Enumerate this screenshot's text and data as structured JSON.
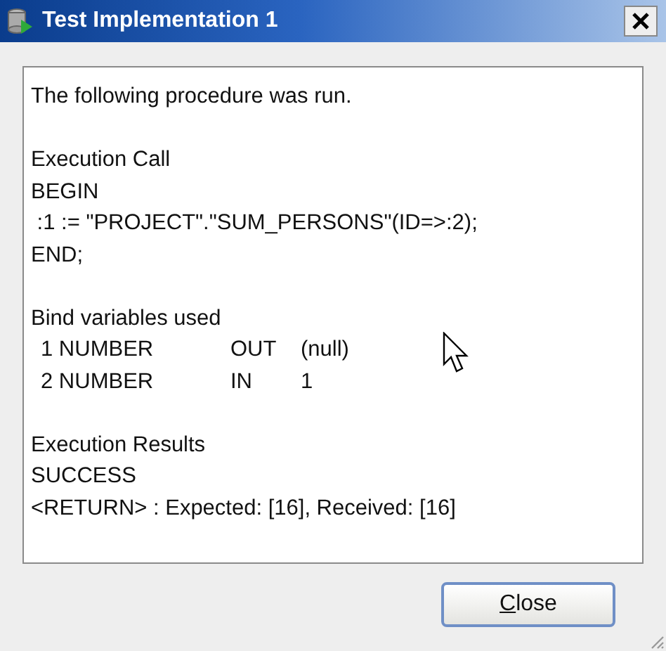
{
  "window": {
    "title": "Test Implementation 1"
  },
  "output": {
    "intro": "The following procedure was run.",
    "execution_call": {
      "heading": "Execution Call",
      "lines": [
        "BEGIN",
        " :1 := \"PROJECT\".\"SUM_PERSONS\"(ID=>:2);",
        "END;"
      ]
    },
    "bind_variables": {
      "heading": "Bind variables used",
      "rows": [
        {
          "position_type": "1 NUMBER",
          "direction": "OUT",
          "value": "(null)"
        },
        {
          "position_type": "2 NUMBER",
          "direction": "IN",
          "value": "1"
        }
      ]
    },
    "results": {
      "heading": "Execution Results",
      "lines": [
        "SUCCESS",
        "<RETURN> : Expected: [16], Received: [16]"
      ]
    }
  },
  "buttons": [
    {
      "label_parts": [
        {
          "text": "C",
          "underlined": true
        },
        {
          "text": "lose",
          "underlined": false
        }
      ]
    }
  ]
}
